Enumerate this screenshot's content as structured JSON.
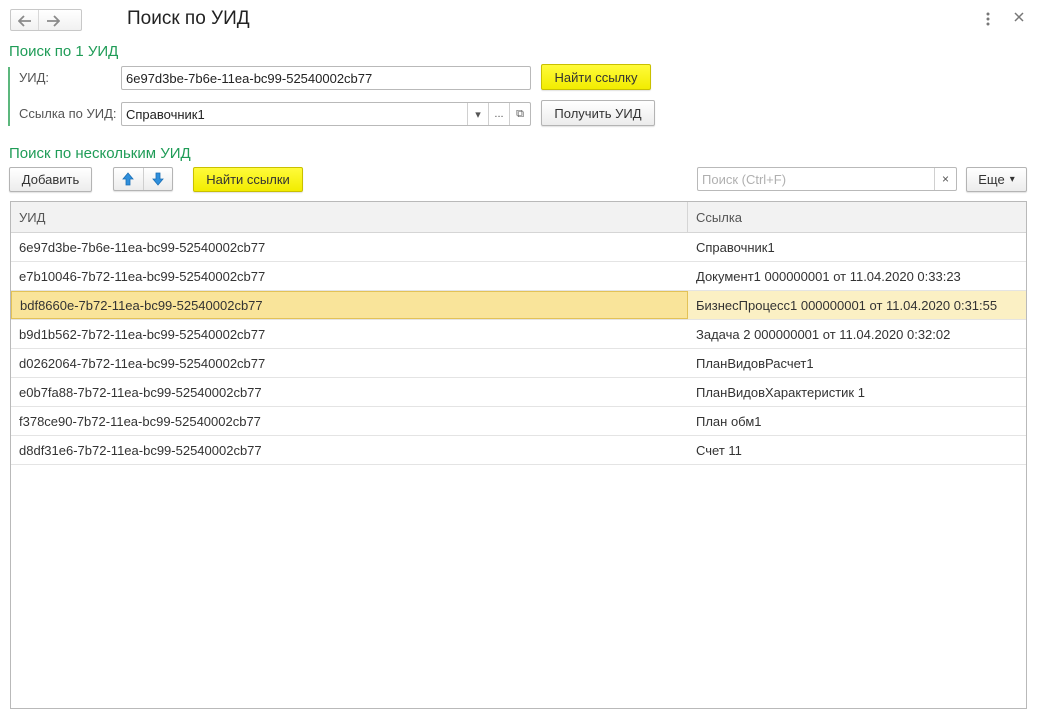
{
  "window": {
    "title": "Поиск по УИД",
    "nav_back_icon": "arrow-left-icon",
    "nav_forward_icon": "arrow-right-icon",
    "menu_icon": "kebab-menu-icon",
    "close_icon": "close-icon"
  },
  "single_search": {
    "section_title": "Поиск по 1 УИД",
    "uid_label": "УИД:",
    "uid_value": "6e97d3be-7b6e-11ea-bc99-52540002cb77",
    "find_link_button": "Найти ссылку",
    "link_label": "Ссылка по УИД:",
    "link_value": "Справочник1",
    "dropdown_icon": "▾",
    "select_icon": "...",
    "open_icon": "⧉",
    "get_uid_button": "Получить УИД"
  },
  "multi_search": {
    "section_title": "Поиск по нескольким УИД",
    "add_button": "Добавить",
    "move_up_icon": "arrow-up-icon",
    "move_down_icon": "arrow-down-icon",
    "find_links_button": "Найти ссылки",
    "search_placeholder": "Поиск (Ctrl+F)",
    "search_clear": "×",
    "more_button": "Еще",
    "more_chevron": "▾"
  },
  "table": {
    "columns": [
      "УИД",
      "Ссылка"
    ],
    "rows": [
      {
        "uid": "6e97d3be-7b6e-11ea-bc99-52540002cb77",
        "link": "Справочник1"
      },
      {
        "uid": "e7b10046-7b72-11ea-bc99-52540002cb77",
        "link": "Документ1 000000001 от 11.04.2020 0:33:23"
      },
      {
        "uid": "bdf8660e-7b72-11ea-bc99-52540002cb77",
        "link": "БизнесПроцесс1 000000001 от 11.04.2020 0:31:55"
      },
      {
        "uid": "b9d1b562-7b72-11ea-bc99-52540002cb77",
        "link": "Задача 2 000000001 от 11.04.2020 0:32:02"
      },
      {
        "uid": "d0262064-7b72-11ea-bc99-52540002cb77",
        "link": "ПланВидовРасчет1"
      },
      {
        "uid": "e0b7fa88-7b72-11ea-bc99-52540002cb77",
        "link": "ПланВидовХарактеристик 1"
      },
      {
        "uid": "f378ce90-7b72-11ea-bc99-52540002cb77",
        "link": "План обм1"
      },
      {
        "uid": "d8df31e6-7b72-11ea-bc99-52540002cb77",
        "link": "Счет 11"
      }
    ],
    "selected_row": 2
  },
  "colors": {
    "section_green": "#1f9c57",
    "button_yellow": "#fff700",
    "selected_row": "#fbf0c4"
  }
}
